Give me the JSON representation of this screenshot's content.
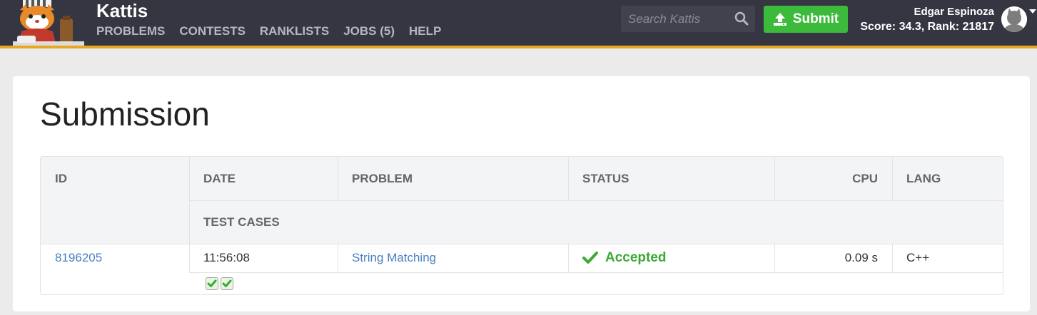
{
  "header": {
    "brand": "Kattis",
    "nav": [
      "PROBLEMS",
      "CONTESTS",
      "RANKLISTS",
      "JOBS (5)",
      "HELP"
    ],
    "search_placeholder": "Search Kattis",
    "submit_label": "Submit",
    "user_name": "Edgar Espinoza",
    "user_stats": "Score: 34.3, Rank: 21817"
  },
  "page": {
    "title": "Submission"
  },
  "table": {
    "headers": {
      "id": "ID",
      "date": "DATE",
      "problem": "PROBLEM",
      "status": "STATUS",
      "cpu": "CPU",
      "lang": "LANG",
      "test_cases": "TEST CASES"
    },
    "row": {
      "id": "8196205",
      "date": "11:56:08",
      "problem": "String Matching",
      "status": "Accepted",
      "cpu": "0.09 s",
      "lang": "C++",
      "test_cases_passed": 2
    }
  },
  "colors": {
    "topbar": "#353641",
    "accent_bar": "#e8a723",
    "submit_green": "#3cba3c",
    "accepted_green": "#3aaa35",
    "link_blue": "#4a7fc1"
  },
  "icons": [
    "kattis-cat-logo",
    "search-icon",
    "upload-icon",
    "user-avatar",
    "dropdown-caret-icon",
    "check-icon"
  ]
}
